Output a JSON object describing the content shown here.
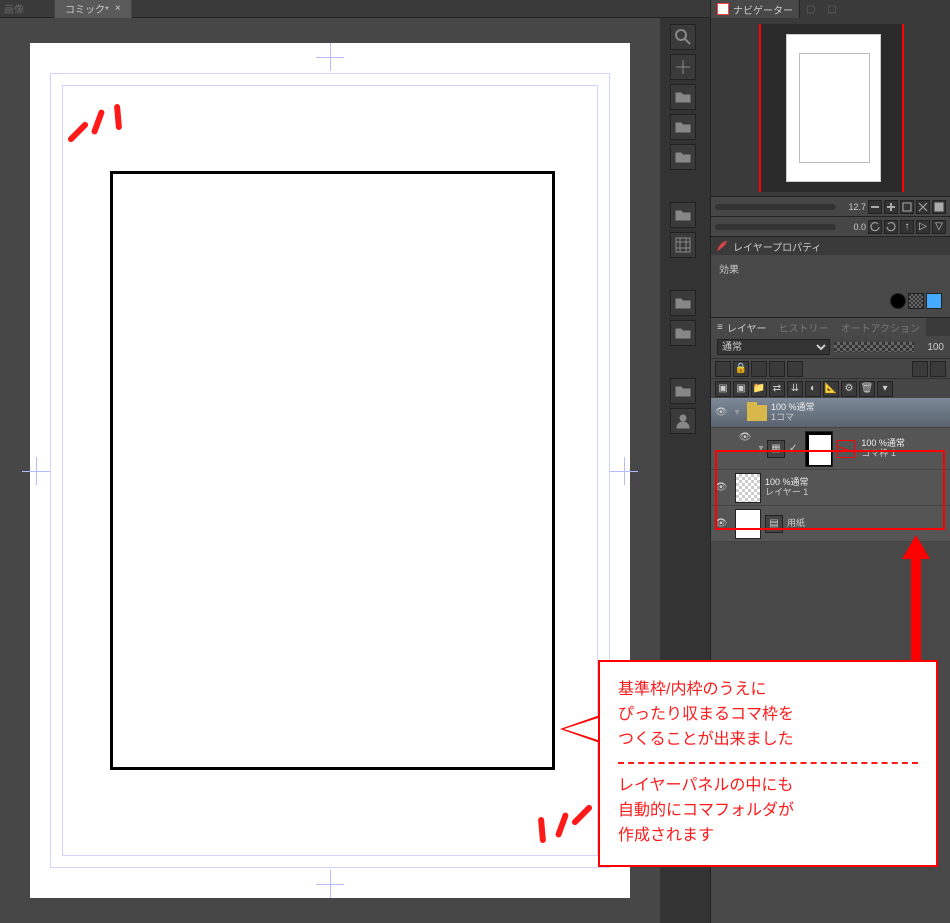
{
  "titlebar": {
    "menu_label": "画像",
    "tab_title": "コミック*",
    "close_glyph": "×"
  },
  "navigator": {
    "tab_label": "ナビゲーター",
    "zoom_value": "12.7",
    "rotate_value": "0.0"
  },
  "layer_property": {
    "tab_label": "レイヤープロパティ",
    "effect_label": "効果"
  },
  "layer_panel": {
    "tab_layer": "レイヤー",
    "tab_history": "ヒストリー",
    "tab_autoaction": "オートアクション",
    "blend_mode": "通常",
    "opacity_value": "100"
  },
  "layers": {
    "folder": {
      "mode": "100 %通常",
      "name": "1コマ"
    },
    "frame": {
      "mode": "100 %通常",
      "name": "コマ枠 1"
    },
    "layer1": {
      "mode": "100 %通常",
      "name": "レイヤー 1"
    },
    "paper": {
      "name": "用紙"
    }
  },
  "callout": {
    "para1_l1": "基準枠/内枠のうえに",
    "para1_l2": "ぴったり収まるコマ枠を",
    "para1_l3": "つくることが出来ました",
    "para2_l1": "レイヤーパネルの中にも",
    "para2_l2": "自動的にコマフォルダが",
    "para2_l3": "作成されます"
  },
  "icons": {
    "eye": "👁"
  }
}
